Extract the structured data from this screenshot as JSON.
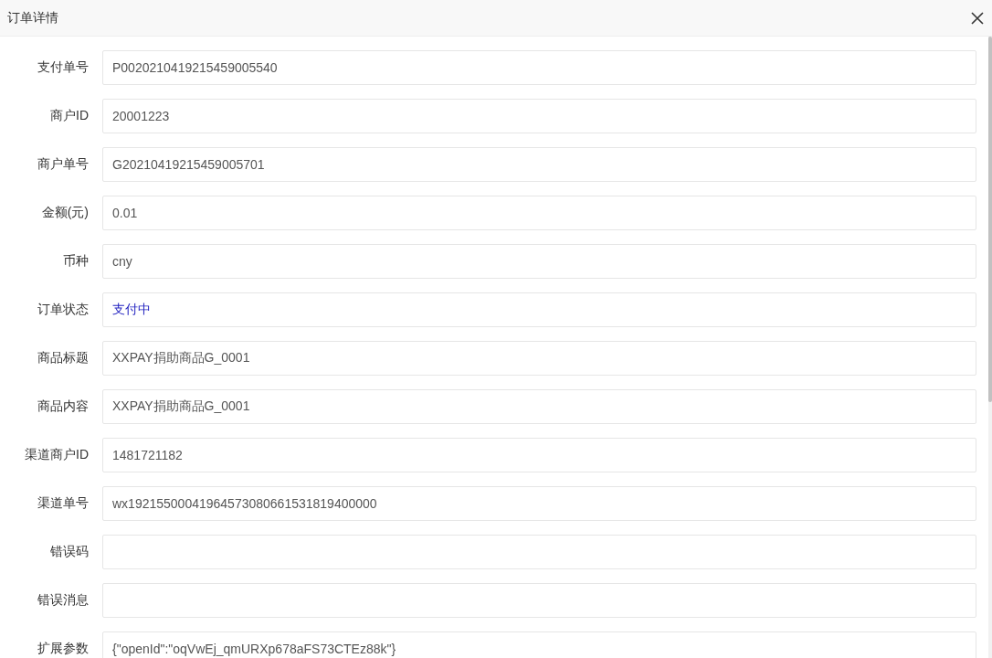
{
  "dialog": {
    "title": "订单详情"
  },
  "fields": [
    {
      "label": "支付单号",
      "value": "P0020210419215459005540",
      "kind": "text"
    },
    {
      "label": "商户ID",
      "value": "20001223",
      "kind": "text"
    },
    {
      "label": "商户单号",
      "value": "G20210419215459005701",
      "kind": "text"
    },
    {
      "label": "金额(元)",
      "value": "0.01",
      "kind": "text"
    },
    {
      "label": "币种",
      "value": "cny",
      "kind": "text"
    },
    {
      "label": "订单状态",
      "value": "支付中",
      "kind": "status"
    },
    {
      "label": "商品标题",
      "value": "XXPAY捐助商品G_0001",
      "kind": "text"
    },
    {
      "label": "商品内容",
      "value": "XXPAY捐助商品G_0001",
      "kind": "text"
    },
    {
      "label": "渠道商户ID",
      "value": "1481721182",
      "kind": "text"
    },
    {
      "label": "渠道单号",
      "value": "wx19215500041964573080661531819400000",
      "kind": "text"
    },
    {
      "label": "错误码"
    },
    {
      "label": "错误消息"
    },
    {
      "label": "扩展参数",
      "value": "{\"openId\":\"oqVwEj_qmURXp678aFS73CTEz88k\"}",
      "kind": "text"
    }
  ]
}
